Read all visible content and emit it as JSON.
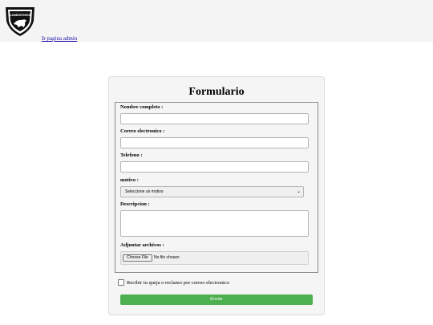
{
  "header": {
    "logo_text": "LAMBORGHINI",
    "admin_link": "Ir pagina admin"
  },
  "form": {
    "title": "Formulario",
    "fields": {
      "name_label": "Nombre completo :",
      "email_label": "Correo electronico :",
      "phone_label": "Telefono :",
      "reason_label": "motivo :",
      "reason_selected": "Seleccione un motivo",
      "description_label": "Descripcion :",
      "attach_label": "Adjuntar archivos :",
      "file_button": "Choose File",
      "file_status": "No file chosen"
    },
    "email_opt_in_label": "Recibir tu queja o reclamo por correo electronico",
    "submit_label": "Enviar"
  }
}
